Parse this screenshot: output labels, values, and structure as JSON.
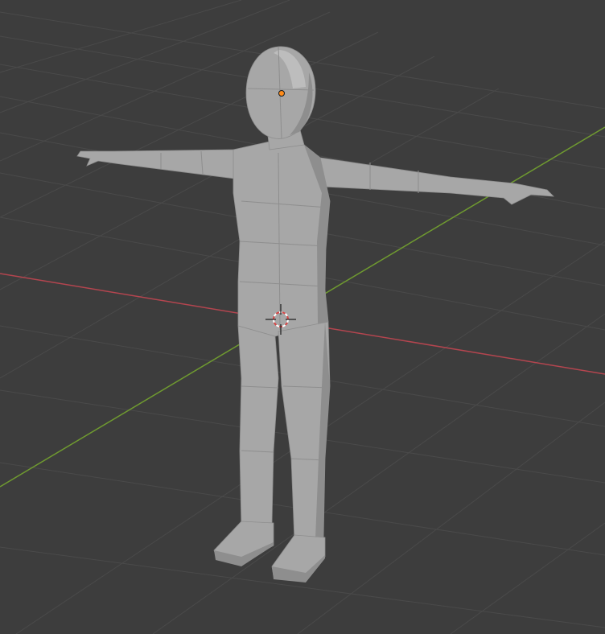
{
  "viewport": {
    "background_color": "#3d3d3d",
    "grid_color": "#4a4a4a",
    "x_axis_color": "#b4454f",
    "y_axis_color": "#6f9a30",
    "mesh_color": "#a7a7a7",
    "mesh_shadow_color": "#8e8e8e",
    "mesh_highlight_color": "#bdbdbd",
    "origin_dot_color": "#ff8c1a",
    "cursor_ring_colors": [
      "#ffffff",
      "#d64545"
    ]
  },
  "icons": {
    "object_origin": "object-origin-icon",
    "cursor_3d": "3d-cursor-icon"
  }
}
